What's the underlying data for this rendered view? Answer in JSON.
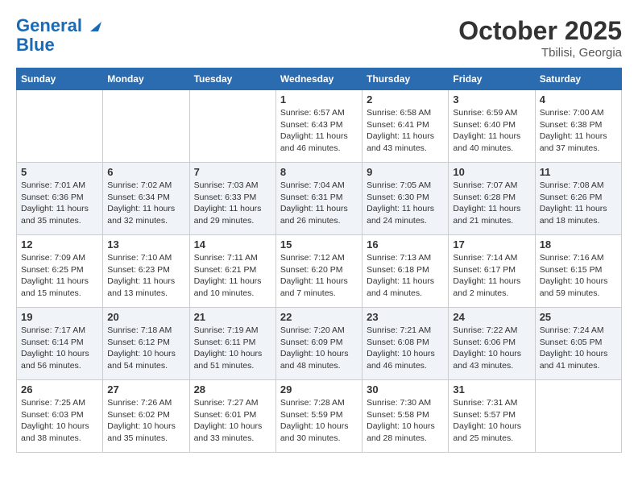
{
  "header": {
    "logo_line1": "General",
    "logo_line2": "Blue",
    "month": "October 2025",
    "location": "Tbilisi, Georgia"
  },
  "weekdays": [
    "Sunday",
    "Monday",
    "Tuesday",
    "Wednesday",
    "Thursday",
    "Friday",
    "Saturday"
  ],
  "weeks": [
    [
      {
        "day": "",
        "info": ""
      },
      {
        "day": "",
        "info": ""
      },
      {
        "day": "",
        "info": ""
      },
      {
        "day": "1",
        "info": "Sunrise: 6:57 AM\nSunset: 6:43 PM\nDaylight: 11 hours and 46 minutes."
      },
      {
        "day": "2",
        "info": "Sunrise: 6:58 AM\nSunset: 6:41 PM\nDaylight: 11 hours and 43 minutes."
      },
      {
        "day": "3",
        "info": "Sunrise: 6:59 AM\nSunset: 6:40 PM\nDaylight: 11 hours and 40 minutes."
      },
      {
        "day": "4",
        "info": "Sunrise: 7:00 AM\nSunset: 6:38 PM\nDaylight: 11 hours and 37 minutes."
      }
    ],
    [
      {
        "day": "5",
        "info": "Sunrise: 7:01 AM\nSunset: 6:36 PM\nDaylight: 11 hours and 35 minutes."
      },
      {
        "day": "6",
        "info": "Sunrise: 7:02 AM\nSunset: 6:34 PM\nDaylight: 11 hours and 32 minutes."
      },
      {
        "day": "7",
        "info": "Sunrise: 7:03 AM\nSunset: 6:33 PM\nDaylight: 11 hours and 29 minutes."
      },
      {
        "day": "8",
        "info": "Sunrise: 7:04 AM\nSunset: 6:31 PM\nDaylight: 11 hours and 26 minutes."
      },
      {
        "day": "9",
        "info": "Sunrise: 7:05 AM\nSunset: 6:30 PM\nDaylight: 11 hours and 24 minutes."
      },
      {
        "day": "10",
        "info": "Sunrise: 7:07 AM\nSunset: 6:28 PM\nDaylight: 11 hours and 21 minutes."
      },
      {
        "day": "11",
        "info": "Sunrise: 7:08 AM\nSunset: 6:26 PM\nDaylight: 11 hours and 18 minutes."
      }
    ],
    [
      {
        "day": "12",
        "info": "Sunrise: 7:09 AM\nSunset: 6:25 PM\nDaylight: 11 hours and 15 minutes."
      },
      {
        "day": "13",
        "info": "Sunrise: 7:10 AM\nSunset: 6:23 PM\nDaylight: 11 hours and 13 minutes."
      },
      {
        "day": "14",
        "info": "Sunrise: 7:11 AM\nSunset: 6:21 PM\nDaylight: 11 hours and 10 minutes."
      },
      {
        "day": "15",
        "info": "Sunrise: 7:12 AM\nSunset: 6:20 PM\nDaylight: 11 hours and 7 minutes."
      },
      {
        "day": "16",
        "info": "Sunrise: 7:13 AM\nSunset: 6:18 PM\nDaylight: 11 hours and 4 minutes."
      },
      {
        "day": "17",
        "info": "Sunrise: 7:14 AM\nSunset: 6:17 PM\nDaylight: 11 hours and 2 minutes."
      },
      {
        "day": "18",
        "info": "Sunrise: 7:16 AM\nSunset: 6:15 PM\nDaylight: 10 hours and 59 minutes."
      }
    ],
    [
      {
        "day": "19",
        "info": "Sunrise: 7:17 AM\nSunset: 6:14 PM\nDaylight: 10 hours and 56 minutes."
      },
      {
        "day": "20",
        "info": "Sunrise: 7:18 AM\nSunset: 6:12 PM\nDaylight: 10 hours and 54 minutes."
      },
      {
        "day": "21",
        "info": "Sunrise: 7:19 AM\nSunset: 6:11 PM\nDaylight: 10 hours and 51 minutes."
      },
      {
        "day": "22",
        "info": "Sunrise: 7:20 AM\nSunset: 6:09 PM\nDaylight: 10 hours and 48 minutes."
      },
      {
        "day": "23",
        "info": "Sunrise: 7:21 AM\nSunset: 6:08 PM\nDaylight: 10 hours and 46 minutes."
      },
      {
        "day": "24",
        "info": "Sunrise: 7:22 AM\nSunset: 6:06 PM\nDaylight: 10 hours and 43 minutes."
      },
      {
        "day": "25",
        "info": "Sunrise: 7:24 AM\nSunset: 6:05 PM\nDaylight: 10 hours and 41 minutes."
      }
    ],
    [
      {
        "day": "26",
        "info": "Sunrise: 7:25 AM\nSunset: 6:03 PM\nDaylight: 10 hours and 38 minutes."
      },
      {
        "day": "27",
        "info": "Sunrise: 7:26 AM\nSunset: 6:02 PM\nDaylight: 10 hours and 35 minutes."
      },
      {
        "day": "28",
        "info": "Sunrise: 7:27 AM\nSunset: 6:01 PM\nDaylight: 10 hours and 33 minutes."
      },
      {
        "day": "29",
        "info": "Sunrise: 7:28 AM\nSunset: 5:59 PM\nDaylight: 10 hours and 30 minutes."
      },
      {
        "day": "30",
        "info": "Sunrise: 7:30 AM\nSunset: 5:58 PM\nDaylight: 10 hours and 28 minutes."
      },
      {
        "day": "31",
        "info": "Sunrise: 7:31 AM\nSunset: 5:57 PM\nDaylight: 10 hours and 25 minutes."
      },
      {
        "day": "",
        "info": ""
      }
    ]
  ]
}
